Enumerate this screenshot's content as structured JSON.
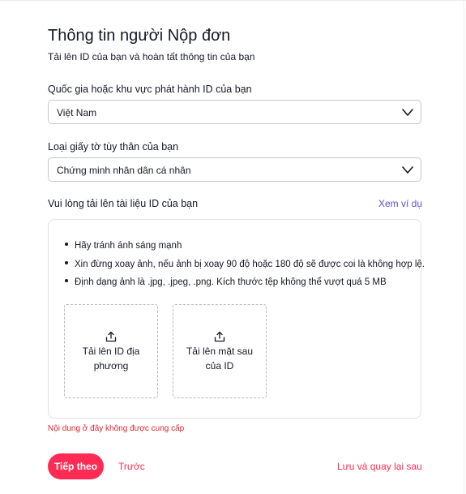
{
  "header": {
    "title": "Thông tin người Nộp đơn",
    "subtitle": "Tải lên ID của bạn và hoàn tất thông tin của bạn"
  },
  "country": {
    "label": "Quốc gia hoặc khu vực phát hành ID của bạn",
    "value": "Việt Nam",
    "icon": "chevron-down-icon"
  },
  "id_type": {
    "label": "Loại giấy tờ tùy thân của bạn",
    "value": "Chứng minh nhân dân cá nhân",
    "icon": "chevron-down-icon"
  },
  "upload": {
    "label": "Vui lòng tải lên tài liệu ID của bạn",
    "example_link": "Xem ví dụ",
    "tips": [
      "Hãy tránh ánh sáng mạnh",
      "Xin đừng xoay ảnh, nếu ảnh bị xoay 90 độ hoặc 180 độ sẽ được coi là không hợp lệ.",
      "Định dạng ảnh là .jpg, .jpeg, .png. Kích thước tệp không thể vượt quá 5 MB"
    ],
    "front": {
      "line1": "Tải lên ID địa",
      "line2": "phương",
      "icon": "upload-icon"
    },
    "back": {
      "line1": "Tải lên mặt sau",
      "line2": "của ID",
      "icon": "upload-icon"
    },
    "error": "Nội dung ở đây không được cung cấp"
  },
  "footer": {
    "next": "Tiếp theo",
    "previous": "Trước",
    "save_later": "Lưu và quay lại sau"
  },
  "colors": {
    "primary": "#fe2c55",
    "link": "#5b4fd6",
    "error": "#e0252f",
    "text": "#161823"
  }
}
